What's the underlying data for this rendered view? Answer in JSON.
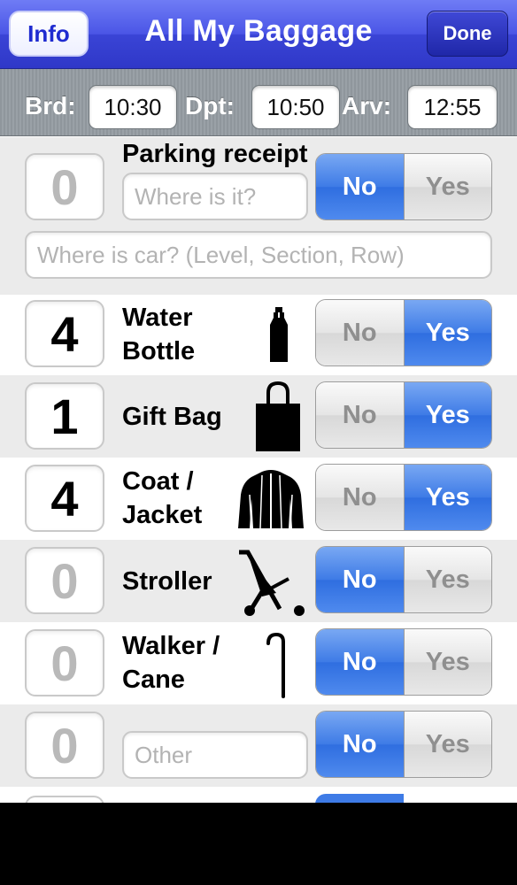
{
  "nav": {
    "title": "All My Baggage",
    "info_label": "Info",
    "done_label": "Done"
  },
  "times": {
    "boarding_label": "Brd:",
    "boarding_value": "10:30",
    "departure_label": "Dpt:",
    "departure_value": "10:50",
    "arrival_label": "Arv:",
    "arrival_value": "12:55"
  },
  "parking": {
    "count": "0",
    "label": "Parking receipt",
    "where_placeholder": "Where is it?",
    "car_placeholder": "Where is car? (Level, Section, Row)",
    "no_label": "No",
    "yes_label": "Yes",
    "selected": "No"
  },
  "items": [
    {
      "count": "4",
      "label_line1": "Water",
      "label_line2": "Bottle",
      "icon": "water-bottle-icon",
      "no_label": "No",
      "yes_label": "Yes",
      "selected": "Yes"
    },
    {
      "count": "1",
      "label_line1": "Gift Bag",
      "label_line2": "",
      "icon": "gift-bag-icon",
      "no_label": "No",
      "yes_label": "Yes",
      "selected": "Yes"
    },
    {
      "count": "4",
      "label_line1": "Coat /",
      "label_line2": "Jacket",
      "icon": "jacket-icon",
      "no_label": "No",
      "yes_label": "Yes",
      "selected": "Yes"
    },
    {
      "count": "0",
      "label_line1": "Stroller",
      "label_line2": "",
      "icon": "stroller-icon",
      "no_label": "No",
      "yes_label": "Yes",
      "selected": "No"
    },
    {
      "count": "0",
      "label_line1": "Walker /",
      "label_line2": "Cane",
      "icon": "cane-icon",
      "no_label": "No",
      "yes_label": "Yes",
      "selected": "No"
    }
  ],
  "other": {
    "count": "0",
    "placeholder": "Other",
    "no_label": "No",
    "yes_label": "Yes",
    "selected": "No"
  },
  "colors": {
    "nav_blue": "#3a44d6",
    "segment_selected": "#3e7be6",
    "row_gray": "#ebebeb"
  }
}
